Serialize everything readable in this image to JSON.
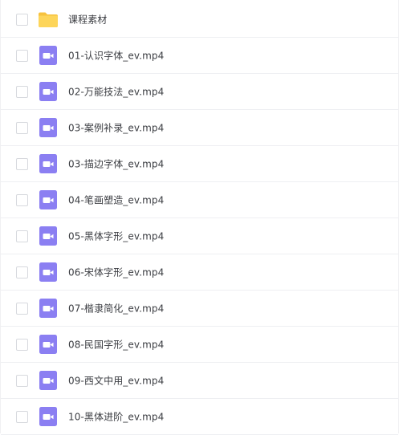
{
  "file_list": {
    "items": [
      {
        "type": "folder",
        "icon": "folder-icon",
        "name": "课程素材"
      },
      {
        "type": "video",
        "icon": "video-file-icon",
        "name": "01-认识字体_ev.mp4"
      },
      {
        "type": "video",
        "icon": "video-file-icon",
        "name": "02-万能技法_ev.mp4"
      },
      {
        "type": "video",
        "icon": "video-file-icon",
        "name": "03-案例补录_ev.mp4"
      },
      {
        "type": "video",
        "icon": "video-file-icon",
        "name": "03-描边字体_ev.mp4"
      },
      {
        "type": "video",
        "icon": "video-file-icon",
        "name": "04-笔画塑造_ev.mp4"
      },
      {
        "type": "video",
        "icon": "video-file-icon",
        "name": "05-黑体字形_ev.mp4"
      },
      {
        "type": "video",
        "icon": "video-file-icon",
        "name": "06-宋体字形_ev.mp4"
      },
      {
        "type": "video",
        "icon": "video-file-icon",
        "name": "07-楷隶简化_ev.mp4"
      },
      {
        "type": "video",
        "icon": "video-file-icon",
        "name": "08-民国字形_ev.mp4"
      },
      {
        "type": "video",
        "icon": "video-file-icon",
        "name": "09-西文中用_ev.mp4"
      },
      {
        "type": "video",
        "icon": "video-file-icon",
        "name": "10-黑体进阶_ev.mp4"
      }
    ]
  },
  "colors": {
    "folder": "#fdd55a",
    "folder_tab": "#f7c23e",
    "video": "#8b7ff2",
    "text": "#3b3d42",
    "divider": "#eeeff2"
  }
}
